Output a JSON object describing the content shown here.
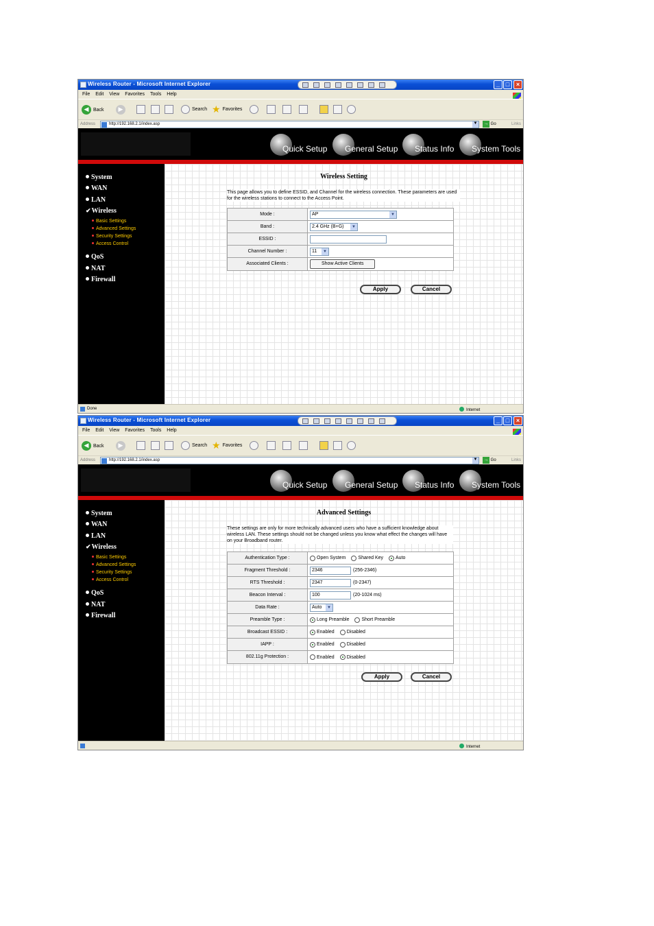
{
  "browser": {
    "window_title": "Wireless Router - Microsoft Internet Explorer",
    "menu": [
      "File",
      "Edit",
      "View",
      "Favorites",
      "Tools",
      "Help"
    ],
    "toolbar": {
      "back": "Back",
      "search": "Search",
      "favorites": "Favorites"
    },
    "address_label": "Address",
    "url": "http://192.168.2.1/index.asp",
    "go": "Go",
    "links": "Links",
    "zone": "Internet",
    "min_glyph": "_",
    "max_glyph": "□",
    "close_glyph": "×",
    "arrow_down": "▼",
    "arrow_left": "◀",
    "arrow_right": "▶",
    "go_arrow": "→"
  },
  "router_nav": [
    "Quick Setup",
    "General Setup",
    "Status Info",
    "System Tools"
  ],
  "sidebar": {
    "check": "✔",
    "top_items": [
      "System",
      "WAN",
      "LAN",
      "Wireless",
      "QoS",
      "NAT",
      "Firewall"
    ],
    "sub_items": [
      "Basic Settings",
      "Advanced Settings",
      "Security Settings",
      "Access Control"
    ]
  },
  "wireless_setting": {
    "status_text": "Done",
    "title": "Wireless Setting",
    "description": "This page allows you to define ESSID, and Channel for the wireless connection. These parameters are used for the wireless stations to connect to the Access Point.",
    "rows": {
      "mode": {
        "label": "Mode :",
        "value": "AP"
      },
      "band": {
        "label": "Band :",
        "value": "2.4 GHz (B+G)"
      },
      "essid": {
        "label": "ESSID :",
        "value": ""
      },
      "channel": {
        "label": "Channel Number :",
        "value": "11"
      },
      "clients": {
        "label": "Associated Clients :",
        "button": "Show Active Clients"
      }
    },
    "apply": "Apply",
    "cancel": "Cancel"
  },
  "advanced_settings": {
    "status_text": "",
    "title": "Advanced Settings",
    "description": "These settings are only for more technically advanced users who have a sufficient knowledge about wireless LAN. These settings should not be changed unless you know what effect the changes will have on your Broadband router.",
    "rows": {
      "auth": {
        "label": "Authentication Type :",
        "options": [
          "Open System",
          "Shared Key",
          "Auto"
        ],
        "selected": "Auto"
      },
      "fragment": {
        "label": "Fragment Threshold :",
        "value": "2346",
        "range": "(256-2346)"
      },
      "rts": {
        "label": "RTS Threshold :",
        "value": "2347",
        "range": "(0-2347)"
      },
      "beacon": {
        "label": "Beacon Interval :",
        "value": "100",
        "range": "(20-1024 ms)"
      },
      "data_rate": {
        "label": "Data Rate :",
        "value": "Auto"
      },
      "preamble": {
        "label": "Preamble Type :",
        "options": [
          "Long Preamble",
          "Short Preamble"
        ],
        "selected": "Long Preamble"
      },
      "broadcast_essid": {
        "label": "Broadcast ESSID :",
        "options": [
          "Enabled",
          "Disabled"
        ],
        "selected": "Enabled"
      },
      "iapp": {
        "label": "IAPP :",
        "options": [
          "Enabled",
          "Disabled"
        ],
        "selected": "Enabled"
      },
      "protection": {
        "label": "802.11g Protection :",
        "options": [
          "Enabled",
          "Disabled"
        ],
        "selected": "Disabled"
      }
    },
    "apply": "Apply",
    "cancel": "Cancel"
  }
}
